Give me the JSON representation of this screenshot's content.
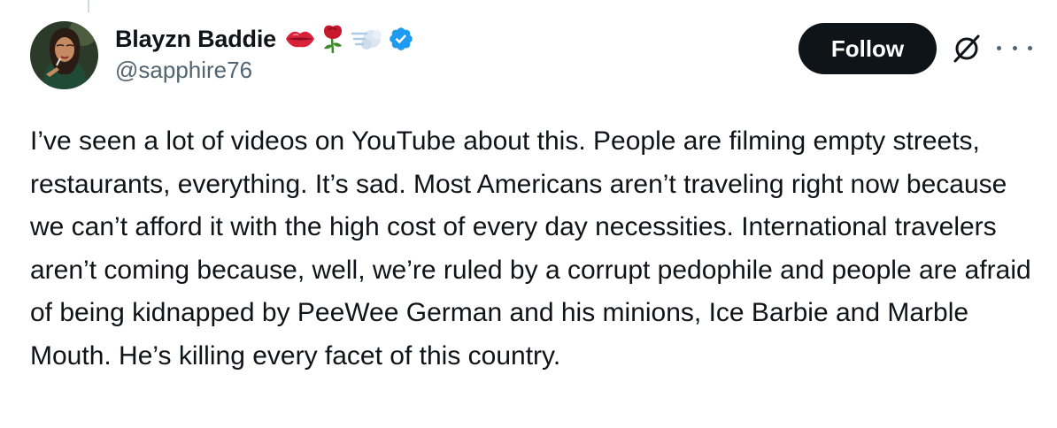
{
  "tweet": {
    "author": {
      "display_name": "Blayzn Baddie",
      "handle": "@sapphire76",
      "name_emojis": [
        "lips-emoji",
        "rose-emoji",
        "dash-emoji"
      ],
      "verified_badge": "verified-badge-icon",
      "avatar": "avatar"
    },
    "actions": {
      "follow_label": "Follow",
      "grok_icon": "grok-icon",
      "more_icon": "more-icon"
    },
    "text": "I’ve seen a lot of videos on YouTube about this. People are filming empty streets, restaurants, everything. It’s sad. Most Americans aren’t traveling right now because we can’t afford it with the high cost of every day necessities. International travelers aren’t coming because, well, we’re ruled by a corrupt pedophile and people are afraid of being kidnapped by PeeWee German and his minions, Ice Barbie and Marble Mouth. He’s killing every facet of this country."
  },
  "colors": {
    "text": "#0f1419",
    "secondary_text": "#536471",
    "follow_button_bg": "#0f1419",
    "verified_blue": "#1d9bf0",
    "thread_line": "#cfd9de"
  }
}
